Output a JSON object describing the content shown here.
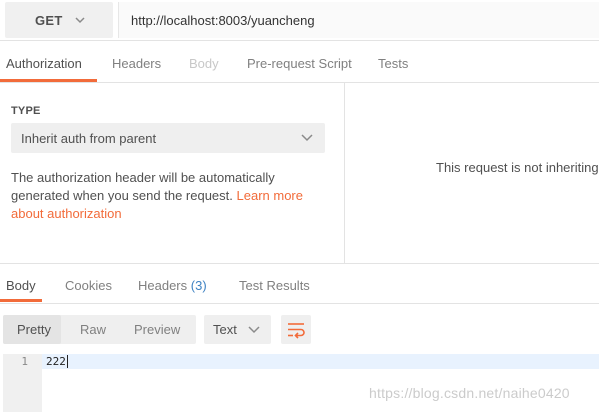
{
  "request": {
    "method": "GET",
    "url": "http://localhost:8003/yuancheng"
  },
  "request_tabs": [
    {
      "label": "Authorization",
      "state": "active"
    },
    {
      "label": "Headers",
      "state": "normal"
    },
    {
      "label": "Body",
      "state": "disabled"
    },
    {
      "label": "Pre-request Script",
      "state": "normal"
    },
    {
      "label": "Tests",
      "state": "normal"
    }
  ],
  "auth": {
    "type_label": "TYPE",
    "type_value": "Inherit auth from parent",
    "description": "The authorization header will be automatically generated when you send the request.",
    "link_text": "Learn more about authorization",
    "right_message": "This request is not inheriting"
  },
  "response_tabs": [
    {
      "label": "Body",
      "state": "active"
    },
    {
      "label": "Cookies",
      "state": "normal"
    },
    {
      "label": "Headers",
      "count": "(3)",
      "state": "normal"
    },
    {
      "label": "Test Results",
      "state": "normal"
    }
  ],
  "response_view": {
    "modes": [
      "Pretty",
      "Raw",
      "Preview"
    ],
    "active_mode": "Pretty",
    "format": "Text",
    "wrap_icon": "wrap-lines-icon"
  },
  "response_body": {
    "lines": [
      {
        "number": "1",
        "text": "222"
      }
    ]
  },
  "watermark": "https://blog.csdn.net/naihe0420",
  "colors": {
    "accent": "#f26b3a",
    "badge": "#3f83c3",
    "line_highlight": "#e8f2fe"
  }
}
